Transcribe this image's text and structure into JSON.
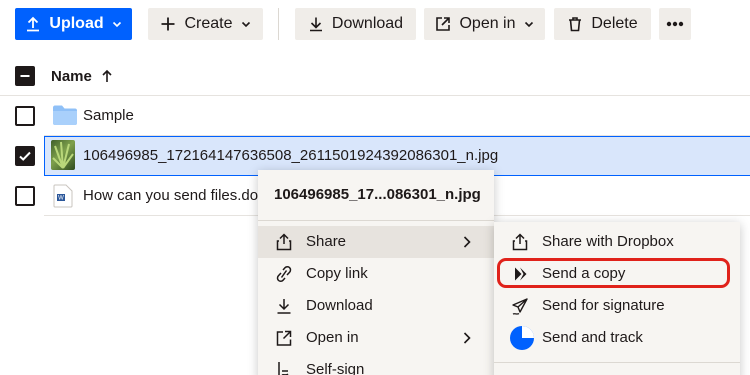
{
  "toolbar": {
    "upload_label": "Upload",
    "create_label": "Create",
    "download_label": "Download",
    "open_in_label": "Open in",
    "delete_label": "Delete",
    "more_label": "•••"
  },
  "list": {
    "name_header": "Name",
    "sort_direction": "ascending",
    "rows": [
      {
        "name": "Sample",
        "type": "folder-icon",
        "checked": false
      },
      {
        "name": "106496985_172164147636508_2611501924392086301_n.jpg",
        "type": "image-thumbnail",
        "checked": true
      },
      {
        "name": "How can you send files.doc",
        "type": "word-doc-icon",
        "checked": false
      }
    ]
  },
  "context_menu": {
    "title": "106496985_17...086301_n.jpg",
    "items": [
      {
        "label": "Share",
        "icon": "share-icon",
        "has_submenu": true,
        "active": true
      },
      {
        "label": "Copy link",
        "icon": "link-icon",
        "has_submenu": false
      },
      {
        "label": "Download",
        "icon": "download-icon",
        "has_submenu": false
      },
      {
        "label": "Open in",
        "icon": "open-external-icon",
        "has_submenu": true
      },
      {
        "label": "Self-sign",
        "icon": "signature-icon",
        "has_submenu": false
      }
    ]
  },
  "share_submenu": {
    "items": [
      {
        "label": "Share with Dropbox",
        "icon": "share-icon"
      },
      {
        "label": "Send a copy",
        "icon": "transfer-icon",
        "highlighted": true
      },
      {
        "label": "Send for signature",
        "icon": "send-signature-icon"
      },
      {
        "label": "Send and track",
        "icon": "docsend-icon"
      }
    ]
  },
  "colors": {
    "primary": "#0061fe",
    "button_bg": "#f0ede9",
    "selection_bg": "#d9e6fb",
    "highlight_ring": "#e0221b",
    "menu_bg": "#f7f5f2"
  }
}
